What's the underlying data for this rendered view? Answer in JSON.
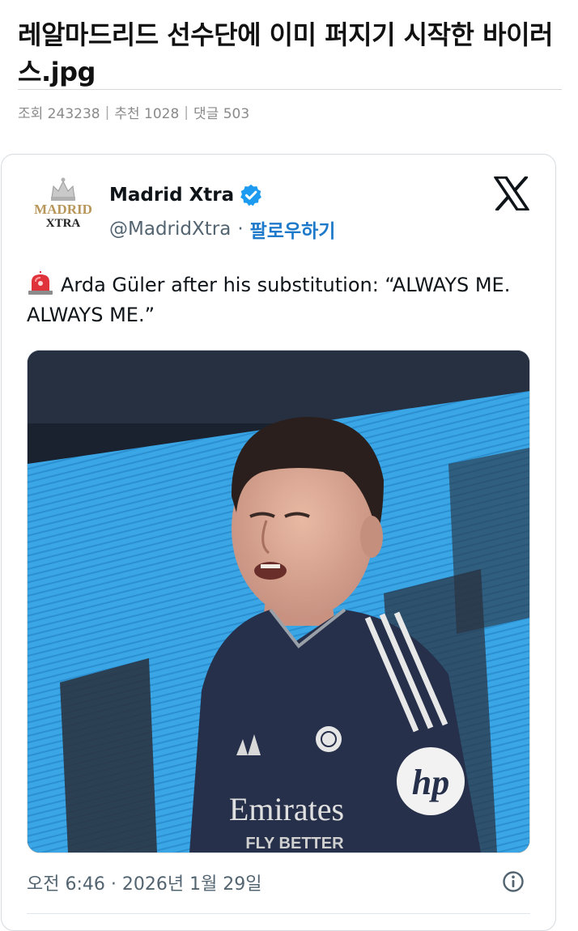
{
  "post": {
    "title": "레알마드리드 선수단에 이미 퍼지기 시작한 바이러스.jpg",
    "meta": {
      "views": "조회 243238",
      "recommends": "추천 1028",
      "comments": "댓글 503"
    }
  },
  "tweet": {
    "avatar_text_top": "MADRID",
    "avatar_text_bottom": "XTRA",
    "author_name": "Madrid Xtra",
    "handle": "@MadridXtra",
    "follow_label": "팔로우하기",
    "text": "Arda Güler after his substitution: “ALWAYS ME. ALWAYS ME.”",
    "media": {
      "sponsor": "Emirates",
      "sponsor_line2": "FLY BETTER",
      "sleeve_logo": "hp"
    },
    "timestamp": "오전 6:46 · 2026년 1월 29일",
    "icons": {
      "verified": "verified-badge-icon",
      "x_logo": "x-logo-icon",
      "siren": "siren-emoji-icon",
      "info": "info-icon"
    },
    "colors": {
      "verified": "#1d9bf0",
      "follow": "#1d79c9",
      "gold": "#b8965a",
      "jersey": "#26304a"
    }
  }
}
